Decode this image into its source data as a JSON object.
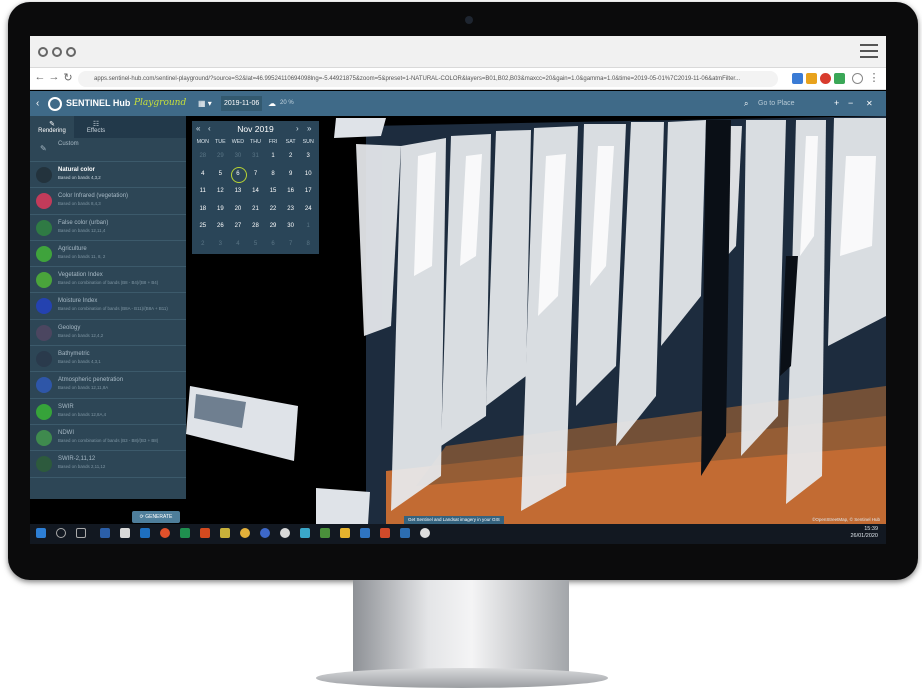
{
  "browser": {
    "url": "apps.sentinel-hub.com/sentinel-playground/?source=S2&lat=46.99524110694098lng=-5.44921875&zoom=5&preset=1-NATURAL-COLOR&layers=B01,B02,B03&maxcc=20&gain=1.0&gamma=1.0&time=2019-05-01%7C2019-11-06&atmFilter..."
  },
  "app": {
    "logo_text": "SENTINEL Hub",
    "logo_script": "Playground",
    "date": "2019-11-06",
    "cloud_coverage": "20 %",
    "search_placeholder": "Go to Place",
    "zoom_in": "+",
    "zoom_out": "−"
  },
  "sidebar": {
    "tabs": [
      {
        "label": "Rendering"
      },
      {
        "label": "Effects"
      }
    ],
    "custom_label": "Custom",
    "presets": [
      {
        "name": "Natural color",
        "desc": "Based on bands 4,3,2",
        "color": "#23333d",
        "active": true
      },
      {
        "name": "Color Infrared (vegetation)",
        "desc": "Based on bands 8,4,3",
        "color": "#c23b5a"
      },
      {
        "name": "False color (urban)",
        "desc": "Based on bands 12,11,4",
        "color": "#2f7a44"
      },
      {
        "name": "Agriculture",
        "desc": "Based on bands 11, 8, 2",
        "color": "#3fa33c"
      },
      {
        "name": "Vegetation Index",
        "desc": "Based on combination of bands (B8 - B4)/(B8 + B4)",
        "color": "#4aa33b"
      },
      {
        "name": "Moisture Index",
        "desc": "Based on combination of bands (B8A - B11)/(B8A + B11)",
        "color": "#2442b0"
      },
      {
        "name": "Geology",
        "desc": "Based on bands 12,4,2",
        "color": "#4b4660"
      },
      {
        "name": "Bathymetric",
        "desc": "Based on bands 4,3,1",
        "color": "#2a3a4c"
      },
      {
        "name": "Atmospheric penetration",
        "desc": "Based on bands 12,11,8A",
        "color": "#2e56a8"
      },
      {
        "name": "SWIR",
        "desc": "Based on bands 12,8A,4",
        "color": "#36a33a"
      },
      {
        "name": "NDWI",
        "desc": "Based on combination of bands (B3 - B8)/(B3 + B8)",
        "color": "#3f8a4e"
      },
      {
        "name": "SWIR-2,11,12",
        "desc": "Based on bands 2,11,12",
        "color": "#2d5a3d"
      }
    ],
    "generate_label": "GENERATE"
  },
  "calendar": {
    "month": "Nov 2019",
    "first_label": "«",
    "prev_label": "‹",
    "next_label": "›",
    "last_label": "»",
    "dow": [
      "MON",
      "TUE",
      "WED",
      "THU",
      "FRI",
      "SAT",
      "SUN"
    ],
    "days": [
      {
        "d": "28",
        "out": true
      },
      {
        "d": "29",
        "out": true
      },
      {
        "d": "30",
        "out": true
      },
      {
        "d": "31",
        "out": true
      },
      {
        "d": "1"
      },
      {
        "d": "2"
      },
      {
        "d": "3"
      },
      {
        "d": "4"
      },
      {
        "d": "5"
      },
      {
        "d": "6",
        "sel": true
      },
      {
        "d": "7"
      },
      {
        "d": "8"
      },
      {
        "d": "9"
      },
      {
        "d": "10"
      },
      {
        "d": "11"
      },
      {
        "d": "12"
      },
      {
        "d": "13"
      },
      {
        "d": "14"
      },
      {
        "d": "15"
      },
      {
        "d": "16"
      },
      {
        "d": "17"
      },
      {
        "d": "18"
      },
      {
        "d": "19"
      },
      {
        "d": "20"
      },
      {
        "d": "21"
      },
      {
        "d": "22"
      },
      {
        "d": "23"
      },
      {
        "d": "24"
      },
      {
        "d": "25"
      },
      {
        "d": "26"
      },
      {
        "d": "27"
      },
      {
        "d": "28"
      },
      {
        "d": "29"
      },
      {
        "d": "30"
      },
      {
        "d": "1",
        "out": true
      },
      {
        "d": "2",
        "out": true
      },
      {
        "d": "3",
        "out": true
      },
      {
        "d": "4",
        "out": true
      },
      {
        "d": "5",
        "out": true
      },
      {
        "d": "6",
        "out": true
      },
      {
        "d": "7",
        "out": true
      },
      {
        "d": "8",
        "out": true
      }
    ]
  },
  "map": {
    "notice": "Get Sentinel and Landsat imagery in your GIS",
    "credit": "©OpenStreetMap, © Sentinel Hub"
  },
  "taskbar": {
    "time": "15:39",
    "date": "26/01/2020"
  }
}
